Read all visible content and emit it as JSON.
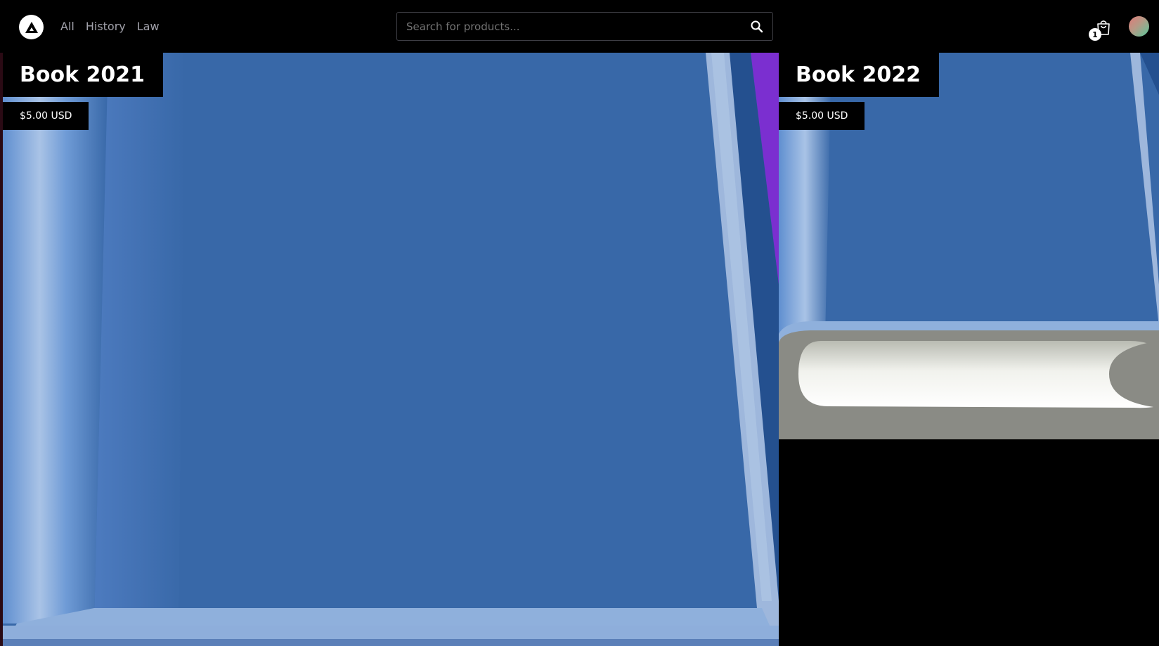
{
  "header": {
    "logo_icon": "logo-triangle-icon",
    "nav": [
      {
        "label": "All"
      },
      {
        "label": "History"
      },
      {
        "label": "Law"
      }
    ],
    "search": {
      "placeholder": "Search for products...",
      "value": "",
      "icon": "search-icon"
    },
    "cart": {
      "icon": "shopping-bag-icon",
      "count": "1"
    },
    "avatar": {
      "icon": "avatar"
    }
  },
  "products": [
    {
      "title": "Book 2021",
      "price": "$5.00 USD",
      "image": "blue-book-cover"
    },
    {
      "title": "Book 2022",
      "price": "$5.00 USD",
      "image": "blue-book-bottom"
    }
  ],
  "colors": {
    "background": "#000000",
    "book_blue": "#3868a8",
    "accent_purple": "#7b2fd0",
    "pages_gray": "#8a8b85"
  }
}
